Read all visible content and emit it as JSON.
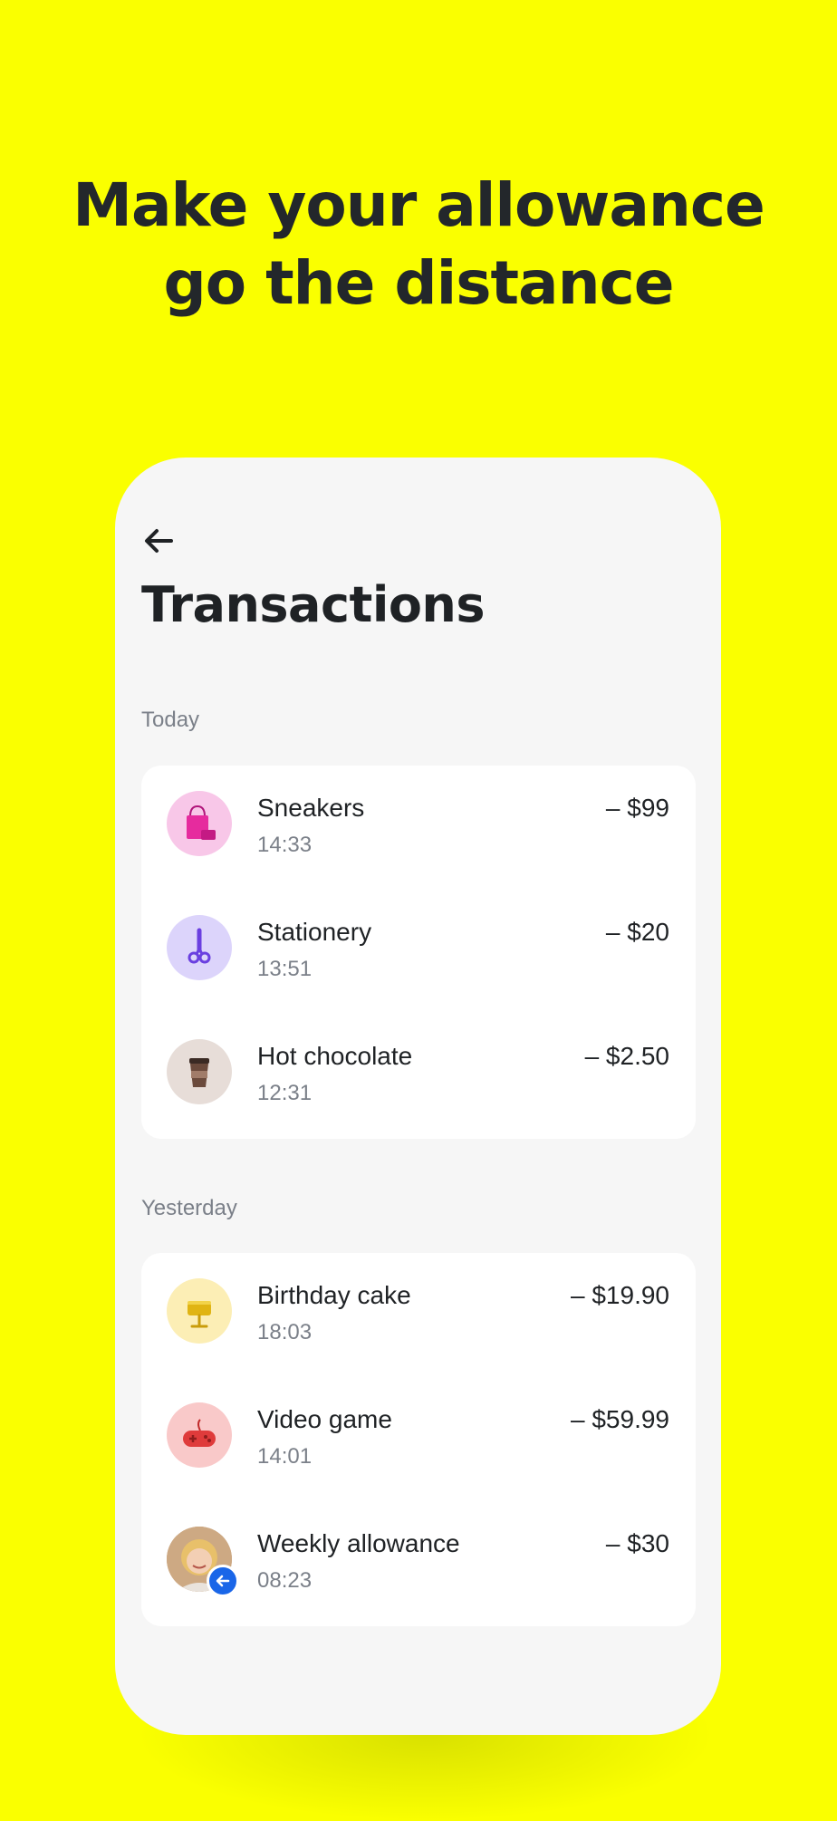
{
  "headline": {
    "line1": "Make your allowance",
    "line2": "go the distance"
  },
  "screen": {
    "back_icon": "arrow-left-icon",
    "title": "Transactions",
    "sections": [
      {
        "label": "Today",
        "items": [
          {
            "name": "Sneakers",
            "time": "14:33",
            "amount": "– $99",
            "icon": "shopping-bag-icon",
            "icon_bg": "#F8C7E8"
          },
          {
            "name": "Stationery",
            "time": "13:51",
            "amount": "– $20",
            "icon": "scissors-icon",
            "icon_bg": "#DCD4FB"
          },
          {
            "name": "Hot chocolate",
            "time": "12:31",
            "amount": "– $2.50",
            "icon": "coffee-cup-icon",
            "icon_bg": "#E7DDD8"
          }
        ]
      },
      {
        "label": "Yesterday",
        "items": [
          {
            "name": "Birthday cake",
            "time": "18:03",
            "amount": "– $19.90",
            "icon": "cake-icon",
            "icon_bg": "#FCEEB5"
          },
          {
            "name": "Video game",
            "time": "14:01",
            "amount": "– $59.99",
            "icon": "gamepad-icon",
            "icon_bg": "#F9C9C9"
          },
          {
            "name": "Weekly allowance",
            "time": "08:23",
            "amount": "– $30",
            "icon": "person-avatar-icon",
            "icon_bg": "#C9A27E",
            "badge": "incoming-arrow-icon"
          }
        ]
      }
    ]
  },
  "colors": {
    "background": "#FAFF00",
    "screen": "#F6F6F6",
    "card": "#FFFFFF",
    "text": "#1F2225",
    "muted": "#7B8089",
    "badge": "#1A66E8"
  }
}
